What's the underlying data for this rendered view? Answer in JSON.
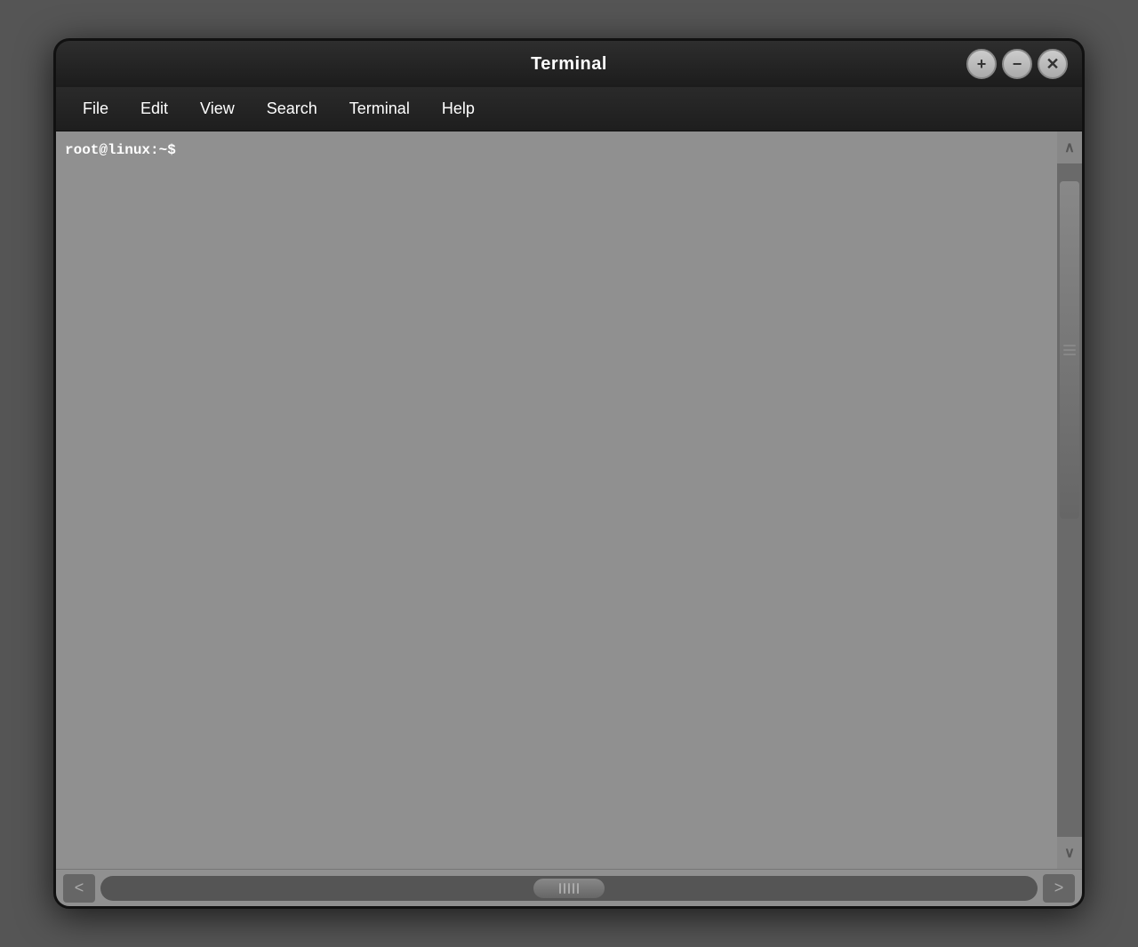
{
  "window": {
    "title": "Terminal",
    "controls": {
      "add": "+",
      "minimize": "−",
      "close": "✕"
    }
  },
  "menubar": {
    "items": [
      {
        "id": "file",
        "label": "File"
      },
      {
        "id": "edit",
        "label": "Edit"
      },
      {
        "id": "view",
        "label": "View"
      },
      {
        "id": "search",
        "label": "Search"
      },
      {
        "id": "terminal",
        "label": "Terminal"
      },
      {
        "id": "help",
        "label": "Help"
      }
    ]
  },
  "terminal": {
    "prompt": "root@linux:~$"
  },
  "scrollbar": {
    "up_arrow": "∧",
    "down_arrow": "∨",
    "left_arrow": "<",
    "right_arrow": ">"
  }
}
